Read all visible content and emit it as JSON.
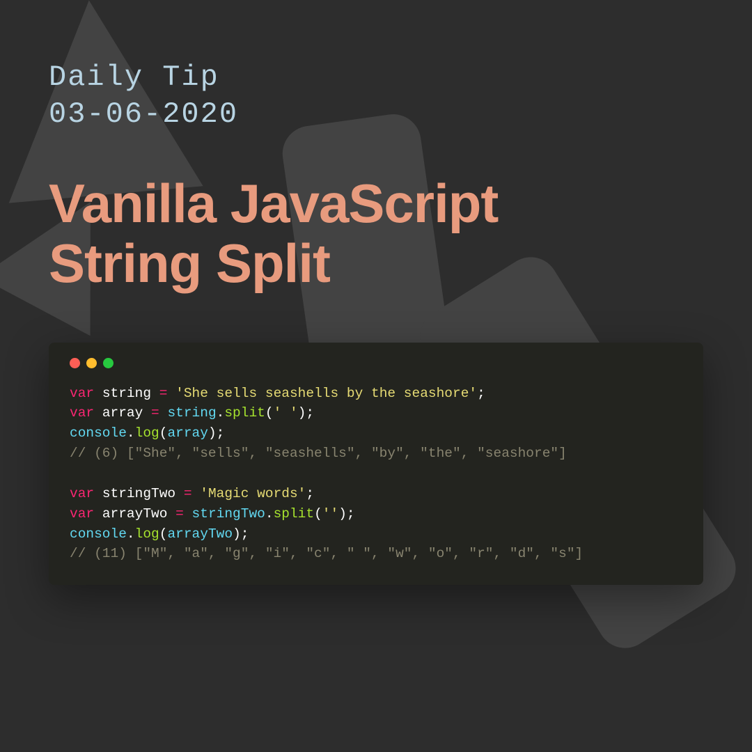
{
  "header": {
    "label": "Daily Tip",
    "date": "03-06-2020"
  },
  "title": {
    "line1": "Vanilla JavaScript",
    "line2": "String Split"
  },
  "code": {
    "line1": {
      "kw": "var",
      "name": "string",
      "eq": "=",
      "str": "'She sells seashells by the seashore'",
      "semi": ";"
    },
    "line2": {
      "kw": "var",
      "name": "array",
      "eq": "=",
      "obj": "string",
      "dot": ".",
      "method": "split",
      "open": "(",
      "arg": "' '",
      "close": ")",
      "semi": ";"
    },
    "line3": {
      "obj": "console",
      "dot": ".",
      "method": "log",
      "open": "(",
      "arg": "array",
      "close": ")",
      "semi": ";"
    },
    "line4": {
      "comment": "// (6) [\"She\", \"sells\", \"seashells\", \"by\", \"the\", \"seashore\"]"
    },
    "line6": {
      "kw": "var",
      "name": "stringTwo",
      "eq": "=",
      "str": "'Magic words'",
      "semi": ";"
    },
    "line7": {
      "kw": "var",
      "name": "arrayTwo",
      "eq": "=",
      "obj": "stringTwo",
      "dot": ".",
      "method": "split",
      "open": "(",
      "arg": "''",
      "close": ")",
      "semi": ";"
    },
    "line8": {
      "obj": "console",
      "dot": ".",
      "method": "log",
      "open": "(",
      "arg": "arrayTwo",
      "close": ")",
      "semi": ";"
    },
    "line9": {
      "comment": "// (11) [\"M\", \"a\", \"g\", \"i\", \"c\", \" \", \"w\", \"o\", \"r\", \"d\", \"s\"]"
    }
  }
}
